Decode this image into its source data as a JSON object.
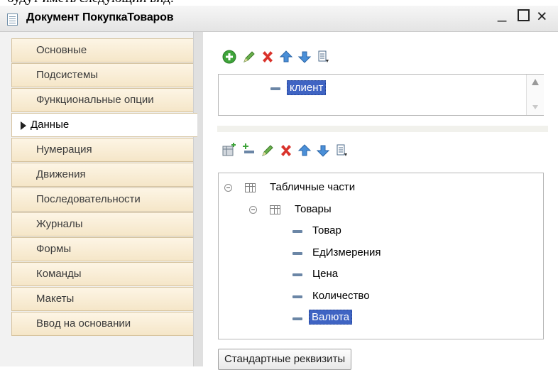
{
  "top_fragment": "будут иметь следующий вид:",
  "window": {
    "title": "Документ ПокупкаТоваров",
    "minimize_label": "_",
    "close_label": "×"
  },
  "sidebar": {
    "items": [
      {
        "label": "Основные"
      },
      {
        "label": "Подсистемы"
      },
      {
        "label": "Функциональные опции"
      },
      {
        "label": "Данные",
        "active": true
      },
      {
        "label": "Нумерация"
      },
      {
        "label": "Движения"
      },
      {
        "label": "Последовательности"
      },
      {
        "label": "Журналы"
      },
      {
        "label": "Формы"
      },
      {
        "label": "Команды"
      },
      {
        "label": "Макеты"
      },
      {
        "label": "Ввод на основании"
      }
    ]
  },
  "attributes": {
    "items": [
      {
        "label": "клиент",
        "selected": true
      }
    ]
  },
  "tabular": {
    "root_label": "Табличные части",
    "group_label": "Товары",
    "items": [
      {
        "label": "Товар"
      },
      {
        "label": "ЕдИзмерения"
      },
      {
        "label": "Цена"
      },
      {
        "label": "Количество"
      },
      {
        "label": "Валюта",
        "selected": true
      }
    ]
  },
  "buttons": {
    "standard_attributes": "Стандартные реквизиты"
  },
  "colors": {
    "selection": "#3f64c3",
    "tab_background": "#f5e6c8",
    "add_green": "#3ea43a",
    "delete_red": "#d9322b",
    "arrow_blue": "#4a8fd8"
  },
  "icons": [
    "add-icon",
    "edit-icon",
    "delete-icon",
    "move-up-icon",
    "move-down-icon",
    "sort-icon",
    "add-table-icon",
    "add-attribute-icon"
  ]
}
